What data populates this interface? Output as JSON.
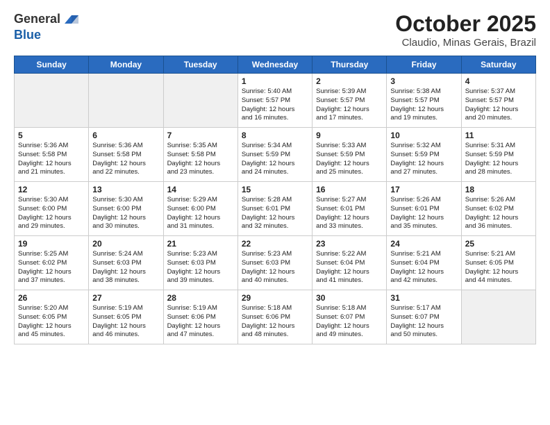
{
  "header": {
    "logo_line1": "General",
    "logo_line2": "Blue",
    "month_title": "October 2025",
    "subtitle": "Claudio, Minas Gerais, Brazil"
  },
  "weekdays": [
    "Sunday",
    "Monday",
    "Tuesday",
    "Wednesday",
    "Thursday",
    "Friday",
    "Saturday"
  ],
  "weeks": [
    [
      {
        "day": "",
        "info": ""
      },
      {
        "day": "",
        "info": ""
      },
      {
        "day": "",
        "info": ""
      },
      {
        "day": "1",
        "info": "Sunrise: 5:40 AM\nSunset: 5:57 PM\nDaylight: 12 hours\nand 16 minutes."
      },
      {
        "day": "2",
        "info": "Sunrise: 5:39 AM\nSunset: 5:57 PM\nDaylight: 12 hours\nand 17 minutes."
      },
      {
        "day": "3",
        "info": "Sunrise: 5:38 AM\nSunset: 5:57 PM\nDaylight: 12 hours\nand 19 minutes."
      },
      {
        "day": "4",
        "info": "Sunrise: 5:37 AM\nSunset: 5:57 PM\nDaylight: 12 hours\nand 20 minutes."
      }
    ],
    [
      {
        "day": "5",
        "info": "Sunrise: 5:36 AM\nSunset: 5:58 PM\nDaylight: 12 hours\nand 21 minutes."
      },
      {
        "day": "6",
        "info": "Sunrise: 5:36 AM\nSunset: 5:58 PM\nDaylight: 12 hours\nand 22 minutes."
      },
      {
        "day": "7",
        "info": "Sunrise: 5:35 AM\nSunset: 5:58 PM\nDaylight: 12 hours\nand 23 minutes."
      },
      {
        "day": "8",
        "info": "Sunrise: 5:34 AM\nSunset: 5:59 PM\nDaylight: 12 hours\nand 24 minutes."
      },
      {
        "day": "9",
        "info": "Sunrise: 5:33 AM\nSunset: 5:59 PM\nDaylight: 12 hours\nand 25 minutes."
      },
      {
        "day": "10",
        "info": "Sunrise: 5:32 AM\nSunset: 5:59 PM\nDaylight: 12 hours\nand 27 minutes."
      },
      {
        "day": "11",
        "info": "Sunrise: 5:31 AM\nSunset: 5:59 PM\nDaylight: 12 hours\nand 28 minutes."
      }
    ],
    [
      {
        "day": "12",
        "info": "Sunrise: 5:30 AM\nSunset: 6:00 PM\nDaylight: 12 hours\nand 29 minutes."
      },
      {
        "day": "13",
        "info": "Sunrise: 5:30 AM\nSunset: 6:00 PM\nDaylight: 12 hours\nand 30 minutes."
      },
      {
        "day": "14",
        "info": "Sunrise: 5:29 AM\nSunset: 6:00 PM\nDaylight: 12 hours\nand 31 minutes."
      },
      {
        "day": "15",
        "info": "Sunrise: 5:28 AM\nSunset: 6:01 PM\nDaylight: 12 hours\nand 32 minutes."
      },
      {
        "day": "16",
        "info": "Sunrise: 5:27 AM\nSunset: 6:01 PM\nDaylight: 12 hours\nand 33 minutes."
      },
      {
        "day": "17",
        "info": "Sunrise: 5:26 AM\nSunset: 6:01 PM\nDaylight: 12 hours\nand 35 minutes."
      },
      {
        "day": "18",
        "info": "Sunrise: 5:26 AM\nSunset: 6:02 PM\nDaylight: 12 hours\nand 36 minutes."
      }
    ],
    [
      {
        "day": "19",
        "info": "Sunrise: 5:25 AM\nSunset: 6:02 PM\nDaylight: 12 hours\nand 37 minutes."
      },
      {
        "day": "20",
        "info": "Sunrise: 5:24 AM\nSunset: 6:03 PM\nDaylight: 12 hours\nand 38 minutes."
      },
      {
        "day": "21",
        "info": "Sunrise: 5:23 AM\nSunset: 6:03 PM\nDaylight: 12 hours\nand 39 minutes."
      },
      {
        "day": "22",
        "info": "Sunrise: 5:23 AM\nSunset: 6:03 PM\nDaylight: 12 hours\nand 40 minutes."
      },
      {
        "day": "23",
        "info": "Sunrise: 5:22 AM\nSunset: 6:04 PM\nDaylight: 12 hours\nand 41 minutes."
      },
      {
        "day": "24",
        "info": "Sunrise: 5:21 AM\nSunset: 6:04 PM\nDaylight: 12 hours\nand 42 minutes."
      },
      {
        "day": "25",
        "info": "Sunrise: 5:21 AM\nSunset: 6:05 PM\nDaylight: 12 hours\nand 44 minutes."
      }
    ],
    [
      {
        "day": "26",
        "info": "Sunrise: 5:20 AM\nSunset: 6:05 PM\nDaylight: 12 hours\nand 45 minutes."
      },
      {
        "day": "27",
        "info": "Sunrise: 5:19 AM\nSunset: 6:05 PM\nDaylight: 12 hours\nand 46 minutes."
      },
      {
        "day": "28",
        "info": "Sunrise: 5:19 AM\nSunset: 6:06 PM\nDaylight: 12 hours\nand 47 minutes."
      },
      {
        "day": "29",
        "info": "Sunrise: 5:18 AM\nSunset: 6:06 PM\nDaylight: 12 hours\nand 48 minutes."
      },
      {
        "day": "30",
        "info": "Sunrise: 5:18 AM\nSunset: 6:07 PM\nDaylight: 12 hours\nand 49 minutes."
      },
      {
        "day": "31",
        "info": "Sunrise: 5:17 AM\nSunset: 6:07 PM\nDaylight: 12 hours\nand 50 minutes."
      },
      {
        "day": "",
        "info": ""
      }
    ]
  ]
}
